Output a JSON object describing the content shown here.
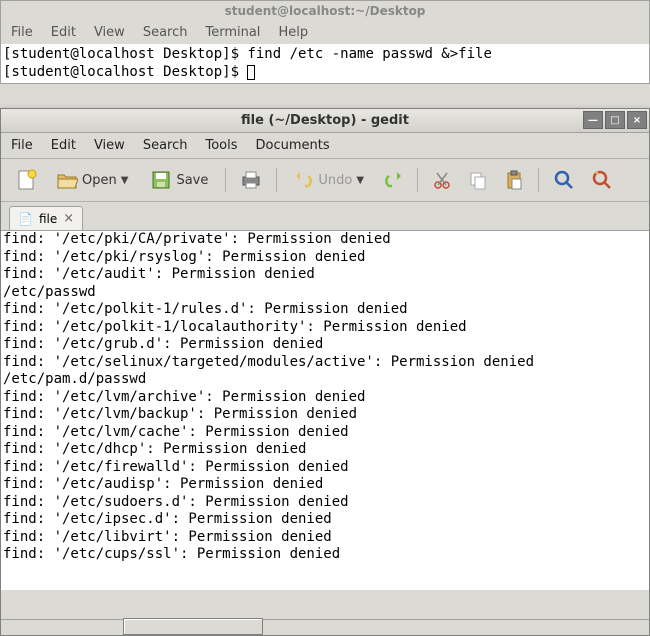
{
  "terminal": {
    "title": "student@localhost:~/Desktop",
    "menu": [
      "File",
      "Edit",
      "View",
      "Search",
      "Terminal",
      "Help"
    ],
    "lines": [
      {
        "prompt": "[student@localhost Desktop]$ ",
        "cmd": "find /etc -name passwd &>file"
      },
      {
        "prompt": "[student@localhost Desktop]$ ",
        "cmd": ""
      }
    ]
  },
  "gedit": {
    "title": "file (~/Desktop) - gedit",
    "menu": [
      "File",
      "Edit",
      "View",
      "Search",
      "Tools",
      "Documents"
    ],
    "toolbar": {
      "open": "Open",
      "save": "Save",
      "undo": "Undo"
    },
    "tab": {
      "icon": "📄",
      "label": "file"
    },
    "content": "find: '/etc/pki/CA/private': Permission denied\nfind: '/etc/pki/rsyslog': Permission denied\nfind: '/etc/audit': Permission denied\n/etc/passwd\nfind: '/etc/polkit-1/rules.d': Permission denied\nfind: '/etc/polkit-1/localauthority': Permission denied\nfind: '/etc/grub.d': Permission denied\nfind: '/etc/selinux/targeted/modules/active': Permission denied\n/etc/pam.d/passwd\nfind: '/etc/lvm/archive': Permission denied\nfind: '/etc/lvm/backup': Permission denied\nfind: '/etc/lvm/cache': Permission denied\nfind: '/etc/dhcp': Permission denied\nfind: '/etc/firewalld': Permission denied\nfind: '/etc/audisp': Permission denied\nfind: '/etc/sudoers.d': Permission denied\nfind: '/etc/ipsec.d': Permission denied\nfind: '/etc/libvirt': Permission denied\nfind: '/etc/cups/ssl': Permission denied"
  }
}
